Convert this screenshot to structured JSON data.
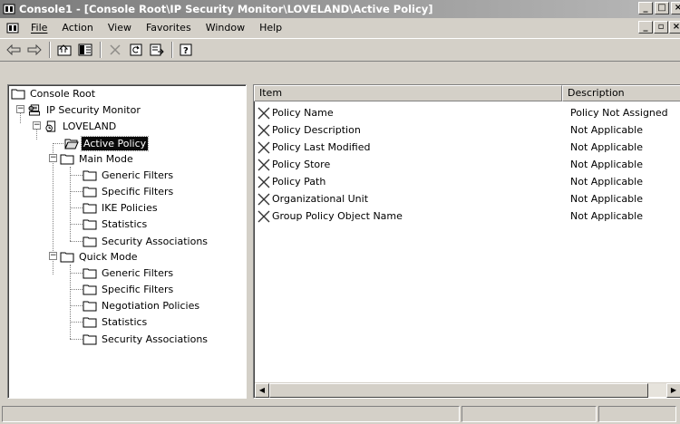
{
  "window": {
    "title": "Console1 - [Console Root\\IP Security Monitor\\LOVELAND\\Active Policy]",
    "buttons": [
      "_",
      "□",
      "×"
    ]
  },
  "menubar": {
    "items": [
      {
        "label": "File",
        "accel": "F"
      },
      {
        "label": "Action",
        "accel": "A"
      },
      {
        "label": "View",
        "accel": "V"
      },
      {
        "label": "Favorites",
        "accel": "o"
      },
      {
        "label": "Window",
        "accel": "W"
      },
      {
        "label": "Help",
        "accel": "H"
      }
    ],
    "mdi_buttons": [
      "_",
      "▫",
      "×"
    ]
  },
  "toolbar": {
    "icons": [
      "back-arrow-icon",
      "forward-arrow-icon",
      "up-one-level-icon",
      "show-hide-tree-icon",
      "delete-icon",
      "refresh-icon",
      "export-list-icon",
      "help-icon"
    ]
  },
  "tree": {
    "root": "Console Root",
    "ipsec": "IP Security Monitor",
    "server": "LOVELAND",
    "active_policy": "Active Policy",
    "main_mode": "Main Mode",
    "main_mode_items": [
      "Generic Filters",
      "Specific Filters",
      "IKE Policies",
      "Statistics",
      "Security Associations"
    ],
    "quick_mode": "Quick Mode",
    "quick_mode_items": [
      "Generic Filters",
      "Specific Filters",
      "Negotiation Policies",
      "Statistics",
      "Security Associations"
    ]
  },
  "list": {
    "columns": [
      "Item",
      "Description"
    ],
    "rows": [
      {
        "item": "Policy Name",
        "description": "Policy Not Assigned"
      },
      {
        "item": "Policy Description",
        "description": "Not Applicable"
      },
      {
        "item": "Policy Last Modified",
        "description": "Not Applicable"
      },
      {
        "item": "Policy Store",
        "description": "Not Applicable"
      },
      {
        "item": "Policy Path",
        "description": "Not Applicable"
      },
      {
        "item": "Organizational Unit",
        "description": "Not Applicable"
      },
      {
        "item": "Group Policy Object Name",
        "description": "Not Applicable"
      }
    ]
  },
  "colors": {
    "face": "#d4d0c8",
    "selection": "#0a0a0a",
    "title_gradient_start": "#7a7a7a"
  }
}
